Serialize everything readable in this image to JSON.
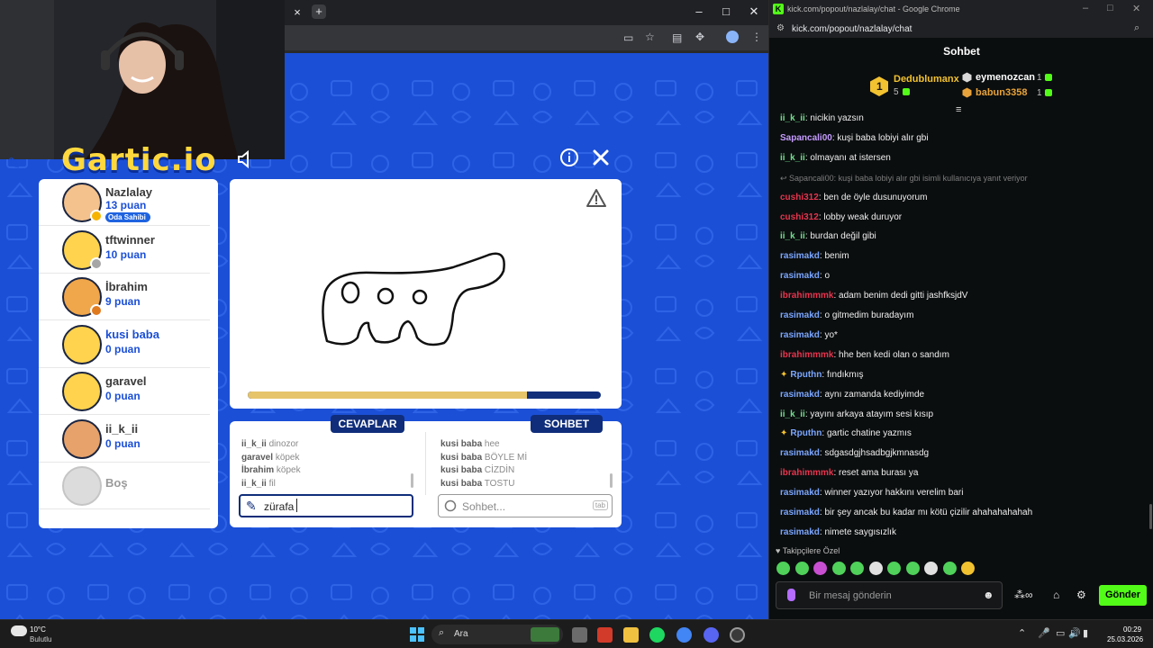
{
  "game_browser": {
    "close_tab": "×",
    "new_tab": "+",
    "minimize": "–",
    "maximize": "□",
    "close_window": "✕"
  },
  "game": {
    "logo": "Gartic.io",
    "players": [
      {
        "name": "Nazlalay",
        "score": "13 puan",
        "badge": "Oda Sahibi",
        "status_color": "#f6b400",
        "skin": "#f4c28c"
      },
      {
        "name": "tftwinner",
        "score": "10 puan",
        "status_color": "#a6a6a6",
        "skin": "#ffd34d"
      },
      {
        "name": "İbrahim",
        "score": "9 puan",
        "status_color": "#e07a1f",
        "skin": "#f0a64a"
      },
      {
        "name": "kusi baba",
        "score": "0 puan",
        "status_color": "",
        "skin": "#ffd34d",
        "drawing": true
      },
      {
        "name": "garavel",
        "score": "0 puan",
        "status_color": "",
        "skin": "#ffd34d"
      },
      {
        "name": "ii_k_ii",
        "score": "0 puan",
        "status_color": "",
        "skin": "#e6a26a"
      },
      {
        "name": "Boş",
        "score": "",
        "status_color": "",
        "skin": "#dcdcdc",
        "empty": true
      }
    ],
    "time_progress": 0.79,
    "answers_tab": "CEVAPLAR",
    "chat_tab": "SOHBET",
    "answers": [
      {
        "user": "ii_k_ii",
        "text": "dinozor"
      },
      {
        "user": "garavel",
        "text": "köpek"
      },
      {
        "user": "İbrahim",
        "text": "köpek"
      },
      {
        "user": "ii_k_ii",
        "text": "fil"
      }
    ],
    "chat_lines": [
      {
        "user": "kusi baba",
        "text": "hee"
      },
      {
        "user": "kusi baba",
        "text": "BÖYLE Mİ"
      },
      {
        "user": "kusi baba",
        "text": "CİZDİN"
      },
      {
        "user": "kusi baba",
        "text": "TOSTU"
      }
    ],
    "answer_value": "zürafa",
    "chat_placeholder": "Sohbet...",
    "tab_hint": "tab"
  },
  "chat_window": {
    "title": "kick.com/popout/nazlalay/chat - Google Chrome",
    "url": "kick.com/popout/nazlalay/chat",
    "header": "Sohbet",
    "leaderboard": [
      {
        "rank": "1",
        "name": "Dedublumanx",
        "count": "5",
        "color": "#f2c230"
      },
      {
        "name": "eymenozcan",
        "count": "1",
        "color": "#ffffff"
      },
      {
        "name": "babun3358",
        "count": "1",
        "color": "#e8a33a"
      }
    ],
    "messages": [
      {
        "user": "ii_k_ii",
        "color": "#6ee08a",
        "text": "nicikin yazsın"
      },
      {
        "user": "Sapancali00",
        "color": "#c59cff",
        "text": "kuşi baba lobiyi alır gbi"
      },
      {
        "user": "ii_k_ii",
        "color": "#6ee08a",
        "text": "olmayanı at istersen"
      },
      {
        "reply": "Sapancali00: kuşi baba lobiyi alır gbi isimli kullanıcıya yanıt veriyor"
      },
      {
        "user": "cushi312",
        "color": "#e8344e",
        "text": "ben de öyle dusunuyorum"
      },
      {
        "user": "cushi312",
        "color": "#e8344e",
        "text": "lobby weak duruyor"
      },
      {
        "user": "ii_k_ii",
        "color": "#6ee08a",
        "text": "burdan değil gibi"
      },
      {
        "user": "rasimakd",
        "color": "#7aa6ff",
        "text": "benim"
      },
      {
        "user": "rasimakd",
        "color": "#7aa6ff",
        "text": "o"
      },
      {
        "user": "ibrahimmmk",
        "color": "#e8344e",
        "text": "adam benim dedi gitti jashfksjdV"
      },
      {
        "user": "rasimakd",
        "color": "#7aa6ff",
        "text": "o gitmedim buradayım"
      },
      {
        "user": "rasimakd",
        "color": "#7aa6ff",
        "text": "yo*"
      },
      {
        "user": "ibrahimmmk",
        "color": "#e8344e",
        "text": "hhe ben kedi olan o sandım"
      },
      {
        "user": "Rputhn",
        "color": "#7aa6ff",
        "text": "fındıkmış",
        "badge": true
      },
      {
        "user": "rasimakd",
        "color": "#7aa6ff",
        "text": "aynı zamanda kediyimde"
      },
      {
        "user": "ii_k_ii",
        "color": "#6ee08a",
        "text": "yayını arkaya atayım sesi kısıp"
      },
      {
        "user": "Rputhn",
        "color": "#7aa6ff",
        "text": "gartic chatine yazmıs",
        "badge": true
      },
      {
        "user": "rasimakd",
        "color": "#7aa6ff",
        "text": "sdgasdgjhsadbgjkmnasdg"
      },
      {
        "user": "ibrahimmmk",
        "color": "#e8344e",
        "text": "reset ama burası ya"
      },
      {
        "user": "rasimakd",
        "color": "#7aa6ff",
        "text": "winner yazıyor hakkını verelim bari"
      },
      {
        "user": "rasimakd",
        "color": "#7aa6ff",
        "text": "bir şey ancak bu kadar mı kötü çizilir ahahahahahah"
      },
      {
        "user": "rasimakd",
        "color": "#7aa6ff",
        "text": "nimete saygısızlık"
      }
    ],
    "followers_only": "Takipçilere Özel",
    "input_placeholder": "Bir mesaj gönderin",
    "send_label": "Gönder"
  },
  "taskbar": {
    "temperature": "10°C",
    "weather": "Bulutlu",
    "search_label": "Ara",
    "time": "00:29",
    "date": "25.03.2026"
  }
}
